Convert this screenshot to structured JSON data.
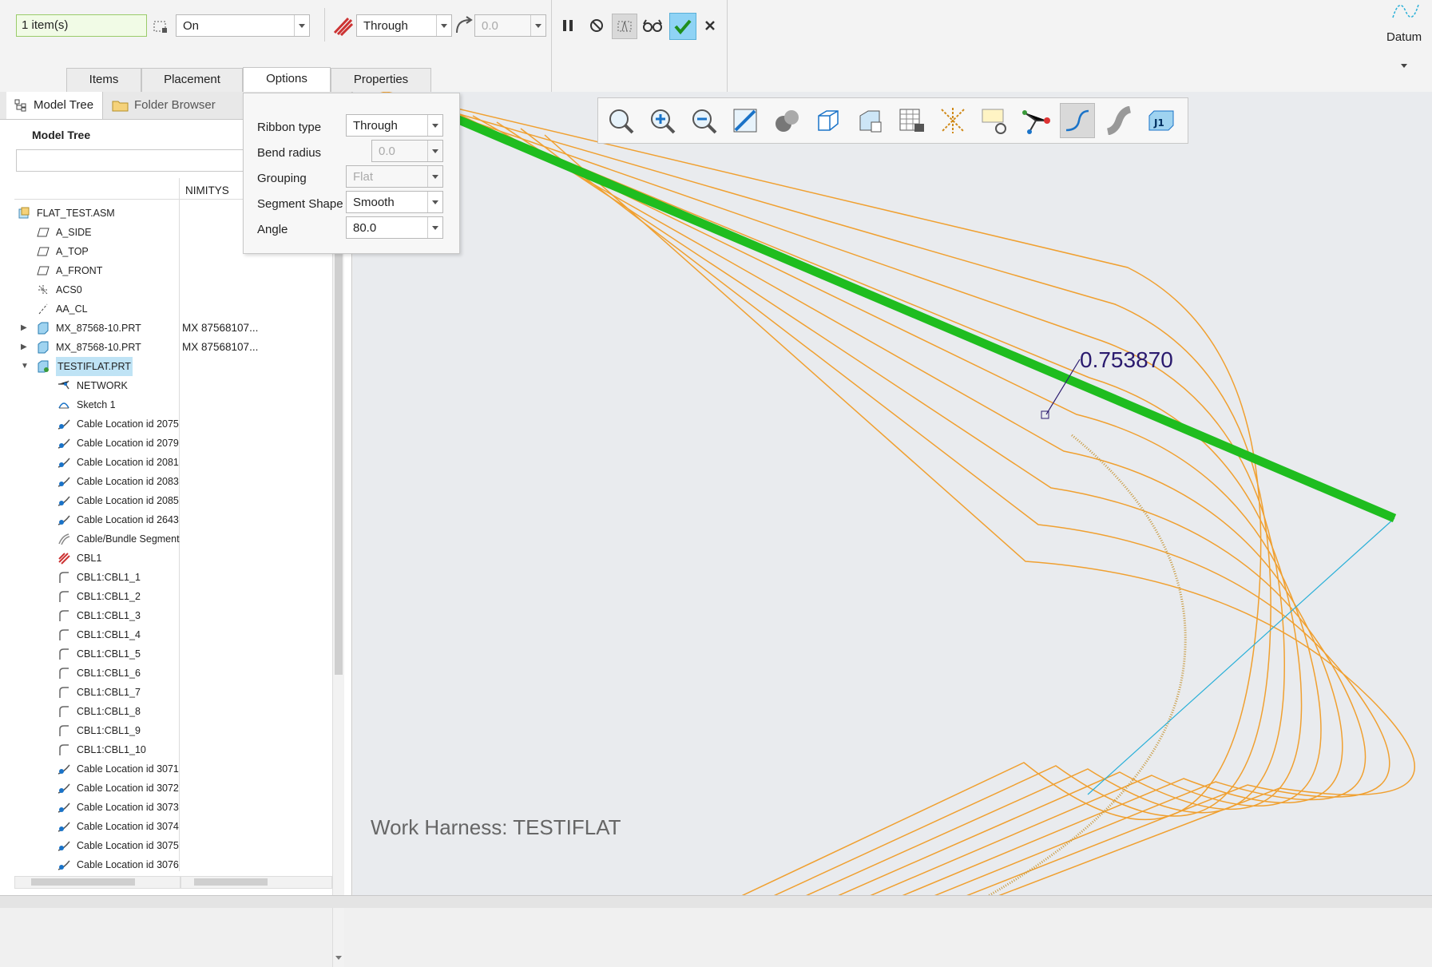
{
  "ribbon": {
    "selection_count": "1 item(s)",
    "mode_select": "On",
    "ribbon_type_select": "Through",
    "bend_value": "0.0",
    "datum_label": "Datum"
  },
  "tabs": [
    {
      "label": "Items"
    },
    {
      "label": "Placement"
    },
    {
      "label": "Options"
    },
    {
      "label": "Properties"
    }
  ],
  "left_tabs": {
    "model_tree": "Model Tree",
    "folder_browser": "Folder Browser"
  },
  "model_tree": {
    "title": "Model Tree",
    "column_header": "NIMITYS",
    "rows": [
      {
        "label": "FLAT_TEST.ASM",
        "col": ""
      },
      {
        "label": "A_SIDE",
        "col": ""
      },
      {
        "label": "A_TOP",
        "col": ""
      },
      {
        "label": "A_FRONT",
        "col": ""
      },
      {
        "label": "ACS0",
        "col": ""
      },
      {
        "label": "AA_CL",
        "col": ""
      },
      {
        "label": "MX_87568-10.PRT",
        "col": "MX  87568107..."
      },
      {
        "label": "MX_87568-10.PRT",
        "col": "MX  87568107..."
      },
      {
        "label": "TESTIFLAT.PRT",
        "col": ""
      },
      {
        "label": "NETWORK",
        "col": ""
      },
      {
        "label": "Sketch 1",
        "col": ""
      },
      {
        "label": "Cable Location id 2075",
        "col": ""
      },
      {
        "label": "Cable Location id 2079",
        "col": ""
      },
      {
        "label": "Cable Location id 2081",
        "col": ""
      },
      {
        "label": "Cable Location id 2083",
        "col": ""
      },
      {
        "label": "Cable Location id 2085",
        "col": ""
      },
      {
        "label": "Cable Location id 2643",
        "col": ""
      },
      {
        "label": "Cable/Bundle Segment",
        "col": ""
      },
      {
        "label": "CBL1",
        "col": ""
      },
      {
        "label": "CBL1:CBL1_1",
        "col": ""
      },
      {
        "label": "CBL1:CBL1_2",
        "col": ""
      },
      {
        "label": "CBL1:CBL1_3",
        "col": ""
      },
      {
        "label": "CBL1:CBL1_4",
        "col": ""
      },
      {
        "label": "CBL1:CBL1_5",
        "col": ""
      },
      {
        "label": "CBL1:CBL1_6",
        "col": ""
      },
      {
        "label": "CBL1:CBL1_7",
        "col": ""
      },
      {
        "label": "CBL1:CBL1_8",
        "col": ""
      },
      {
        "label": "CBL1:CBL1_9",
        "col": ""
      },
      {
        "label": "CBL1:CBL1_10",
        "col": ""
      },
      {
        "label": "Cable Location id 3071",
        "col": ""
      },
      {
        "label": "Cable Location id 3072",
        "col": ""
      },
      {
        "label": "Cable Location id 3073",
        "col": ""
      },
      {
        "label": "Cable Location id 3074",
        "col": ""
      },
      {
        "label": "Cable Location id 3075",
        "col": ""
      },
      {
        "label": "Cable Location id 3076",
        "col": ""
      }
    ]
  },
  "options": {
    "ribbon_type_label": "Ribbon type",
    "ribbon_type_value": "Through",
    "bend_radius_label": "Bend radius",
    "bend_radius_value": "0.0",
    "grouping_label": "Grouping",
    "grouping_value": "Flat",
    "segment_shape_label": "Segment Shape",
    "segment_shape_value": "Smooth",
    "angle_label": "Angle",
    "angle_value": "80.0"
  },
  "graphics": {
    "dimension_value": "0.753870",
    "work_harness": "Work Harness: TESTIFLAT",
    "colors": {
      "cable": "#f0a030",
      "ribbon": "#1fbd1f",
      "guide": "#2ab0d8",
      "background": "#e9ebee"
    }
  }
}
